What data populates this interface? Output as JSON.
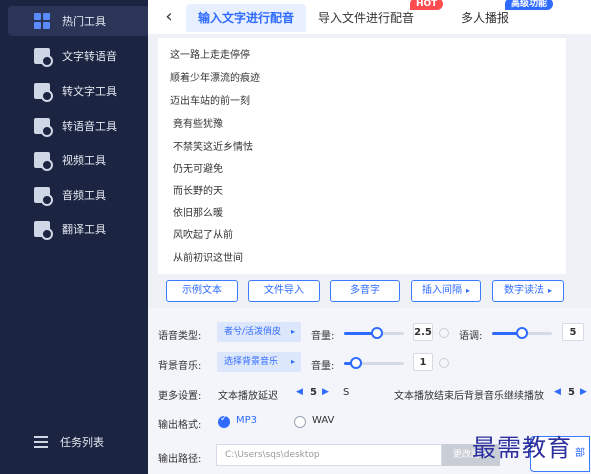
{
  "sidebar": {
    "items": [
      {
        "label": "热门工具",
        "icon": "grid-icon"
      },
      {
        "label": "文字转语音",
        "icon": "tool-icon"
      },
      {
        "label": "转文字工具",
        "icon": "tool-icon"
      },
      {
        "label": "转语音工具",
        "icon": "tool-icon"
      },
      {
        "label": "视频工具",
        "icon": "tool-icon"
      },
      {
        "label": "音频工具",
        "icon": "tool-icon"
      },
      {
        "label": "翻译工具",
        "icon": "tool-icon"
      }
    ],
    "task_list": "任务列表"
  },
  "tabs": {
    "back": "‹",
    "items": [
      {
        "label": "输入文字进行配音"
      },
      {
        "label": "导入文件进行配音",
        "badge": "HOT"
      },
      {
        "label": "多人播报",
        "badge": "高级功能"
      }
    ]
  },
  "editor": {
    "lines": [
      "这一路上走走停停",
      "顺着少年漂流的痕迹",
      "迈出车站的前一刻",
      "竟有些犹豫",
      "不禁笑这近乡情怯",
      "仍无可避免",
      "而长野的天",
      "依旧那么暖",
      "风吹起了从前",
      "从前初识这世间"
    ]
  },
  "actions": {
    "sample_text": "示例文本",
    "import_file": "文件导入",
    "polyphone": "多音字",
    "insert_pause": "插入间隔",
    "number_reading": "数字读法"
  },
  "settings": {
    "voice_type_label": "语音类型:",
    "voice_type_value": "者兮/活泼俏皮",
    "volume_label": "音量:",
    "volume_value": "2.5",
    "tone_label": "语调:",
    "tone_value": "5",
    "bgm_label": "背景音乐:",
    "bgm_value": "选择背景音乐",
    "bgm_volume_label": "音量:",
    "bgm_volume_value": "1",
    "more_label": "更多设置:",
    "delay_label": "文本播放延迟",
    "delay_value": "5",
    "delay_unit": "S",
    "continue_label": "文本播放结束后背景音乐继续播放",
    "continue_value": "5",
    "format_label": "输出格式:",
    "format_mp3": "MP3",
    "format_wav": "WAV",
    "path_label": "输出路径:",
    "path_value": "C:\\Users\\sqs\\desktop",
    "path_button": "更改路径",
    "start_button": "部"
  },
  "watermark": "最需教育",
  "colors": {
    "sidebar_bg": "#1b2440",
    "accent": "#2f6bff",
    "hot": "#ff4d4f"
  },
  "levels": {
    "volume": 0.55,
    "tone": 0.5,
    "bgm_volume": 0.2
  }
}
